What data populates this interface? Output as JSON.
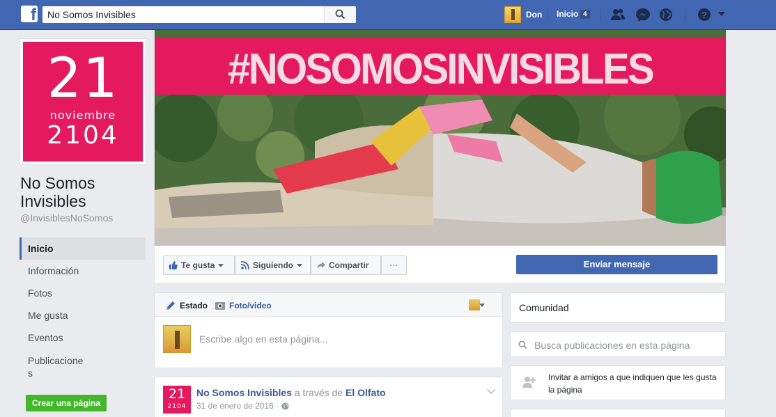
{
  "topbar": {
    "logo_letter": "f",
    "search_value": "No Somos Invisibles",
    "user_name": "Don",
    "home_label": "Inicio",
    "home_badge": "4",
    "icons": [
      "friend-requests-icon",
      "messenger-icon",
      "notifications-globe-icon",
      "help-icon"
    ]
  },
  "page": {
    "profile": {
      "day": "21",
      "month": "noviembre",
      "year": "2104"
    },
    "name": "No Somos Invisibles",
    "handle": "@InvisiblesNoSomos",
    "nav": [
      {
        "label": "Inicio",
        "active": true
      },
      {
        "label": "Información"
      },
      {
        "label": "Fotos"
      },
      {
        "label": "Me gusta"
      },
      {
        "label": "Eventos"
      },
      {
        "label": "Publicaciones"
      }
    ],
    "create_page": "Crear una página"
  },
  "cover": {
    "title": "#NOSOMOSINVISIBLES"
  },
  "actions": {
    "like": "Te gusta",
    "following": "Siguiendo",
    "share": "Compartir",
    "more": "···",
    "send_message": "Enviar mensaje"
  },
  "composer": {
    "tab_status": "Estado",
    "tab_photo": "Foto/video",
    "placeholder": "Escribe algo en esta página..."
  },
  "post": {
    "avatar_day": "21",
    "avatar_year": "2104",
    "author": "No Somos Invisibles",
    "via": "a través de",
    "via_page": "El Olfato",
    "date": "31 de enero de 2016 ·"
  },
  "sidebar_right": {
    "community": "Comunidad",
    "search_placeholder": "Busca publicaciones en esta página",
    "invite": "Invitar a amigos a que indiquen que les gusta la página"
  },
  "colors": {
    "brand": "#4267b2",
    "pink": "#e5195e",
    "green_button": "#42b72a"
  }
}
